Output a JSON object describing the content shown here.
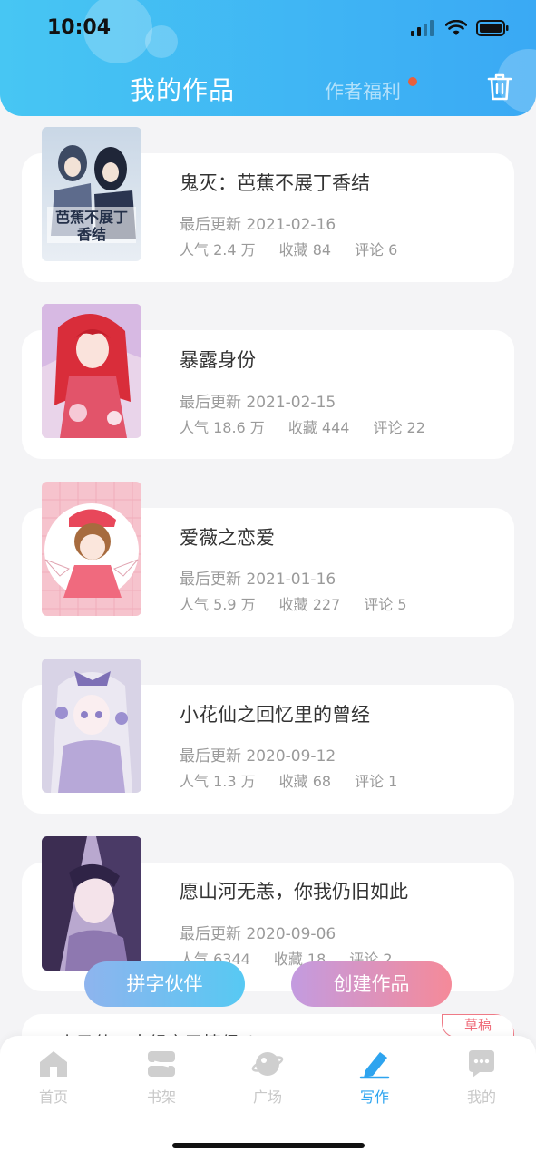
{
  "status_bar": {
    "time": "10:04"
  },
  "header": {
    "title": "我的作品",
    "welfare_label": "作者福利"
  },
  "works": [
    {
      "title": "鬼灭：芭蕉不展丁香结",
      "updated": "最后更新 2021-02-16",
      "popularity": "人气 2.4 万",
      "favorites": "收藏 84",
      "comments": "评论 6",
      "cover_text": "芭蕉不展丁香结"
    },
    {
      "title": "暴露身份",
      "updated": "最后更新 2021-02-15",
      "popularity": "人气 18.6 万",
      "favorites": "收藏 444",
      "comments": "评论 22"
    },
    {
      "title": "爱薇之恋爱",
      "updated": "最后更新 2021-01-16",
      "popularity": "人气 5.9 万",
      "favorites": "收藏 227",
      "comments": "评论 5"
    },
    {
      "title": "小花仙之回忆里的曾经",
      "updated": "最后更新 2020-09-12",
      "popularity": "人气 1.3 万",
      "favorites": "收藏 68",
      "comments": "评论 1"
    },
    {
      "title": "愿山河无恙，你我仍旧如此",
      "updated": "最后更新 2020-09-06",
      "popularity": "人气 6344",
      "favorites": "收藏 18",
      "comments": "评论 2"
    }
  ],
  "draft": {
    "badge": "草稿",
    "title_partial": "小马仙四大组之圣情侣八"
  },
  "buttons": {
    "partner": "拼字伙伴",
    "create": "创建作品"
  },
  "tabbar": [
    {
      "label": "首页",
      "icon": "home-icon"
    },
    {
      "label": "书架",
      "icon": "bookshelf-icon"
    },
    {
      "label": "广场",
      "icon": "planet-icon"
    },
    {
      "label": "写作",
      "icon": "pen-icon",
      "active": true
    },
    {
      "label": "我的",
      "icon": "chat-bubble-icon"
    }
  ],
  "colors": {
    "header_start": "#47c6f3",
    "header_end": "#3aa9f4",
    "active_tab": "#2ea4ef",
    "notification_dot": "#e8603c"
  }
}
